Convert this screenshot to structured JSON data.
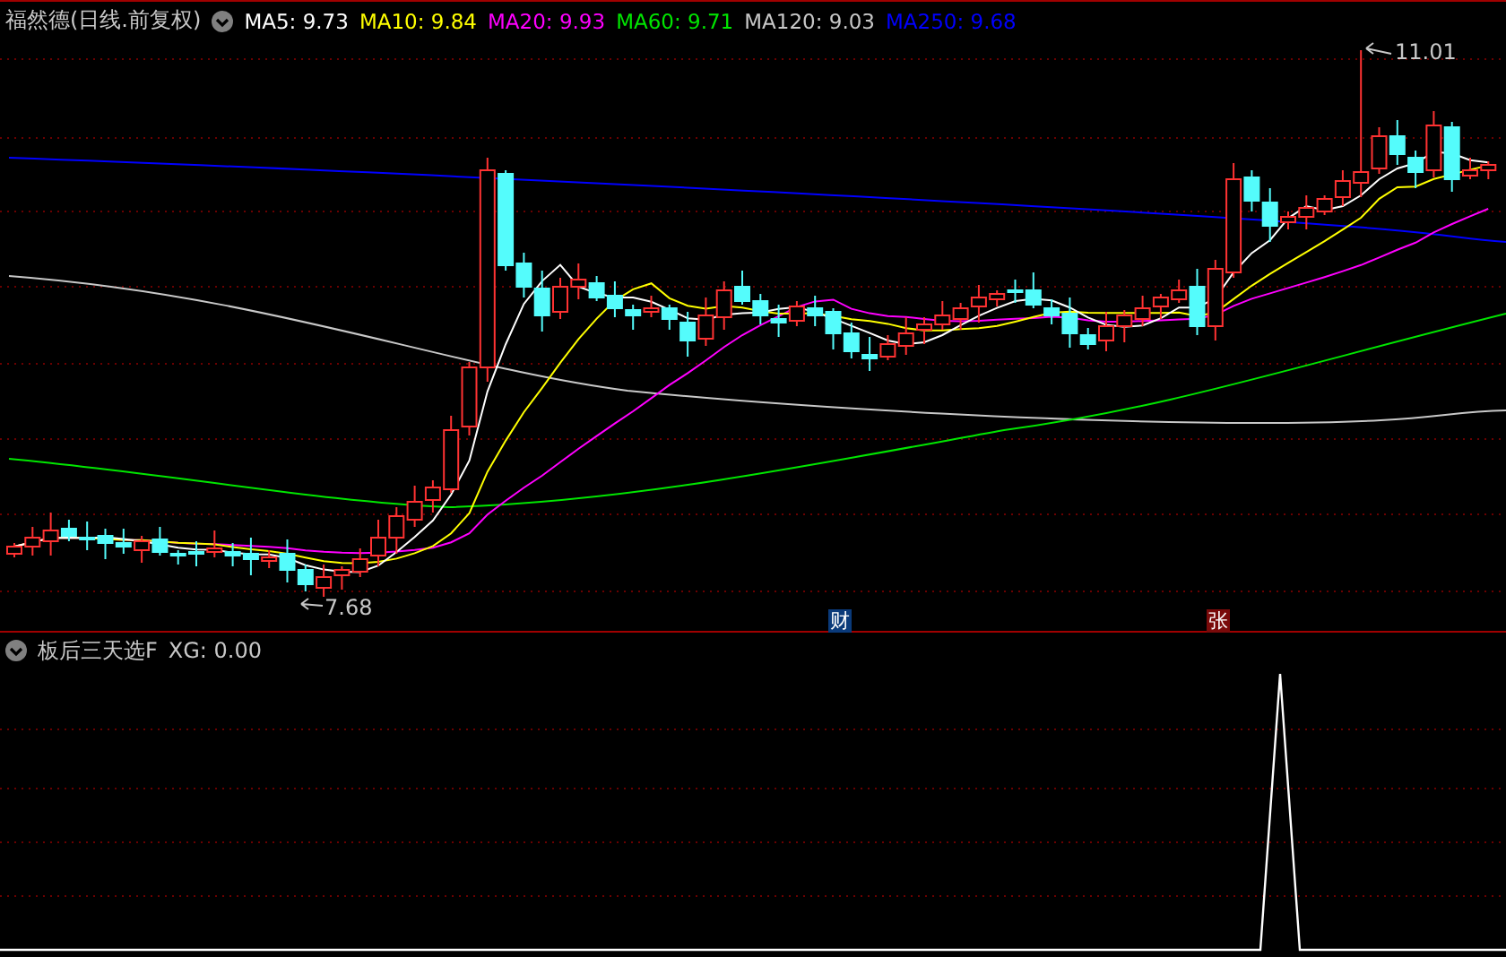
{
  "title": "福然德(日线.前复权)",
  "moving_averages": [
    {
      "label": "MA5: 9.73",
      "color": "#ffffff"
    },
    {
      "label": "MA10: 9.84",
      "color": "#ffff00"
    },
    {
      "label": "MA20: 9.93",
      "color": "#ff00ff"
    },
    {
      "label": "MA60: 9.71",
      "color": "#00e600"
    },
    {
      "label": "MA120: 9.03",
      "color": "#c8c8c8"
    },
    {
      "label": "MA250: 9.68",
      "color": "#0000ff"
    }
  ],
  "price_labels": [
    {
      "kind": "high",
      "text": "11.01"
    },
    {
      "kind": "low",
      "text": "7.68"
    }
  ],
  "event_markers": [
    {
      "text": "财",
      "color": "#0a3a7a"
    },
    {
      "text": "张",
      "color": "#7a0a0a"
    }
  ],
  "indicator": {
    "title": "板后三天选F",
    "reading": "XG: 0.00"
  }
}
